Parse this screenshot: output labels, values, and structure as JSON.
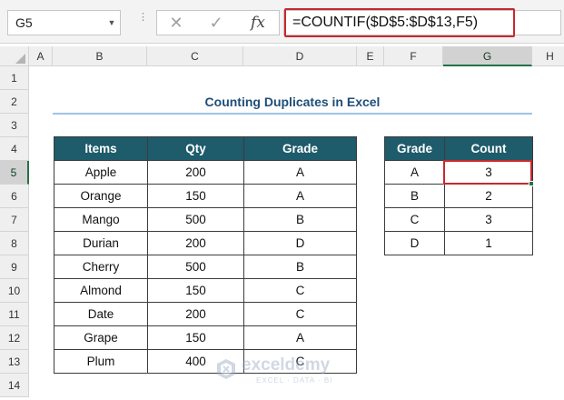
{
  "name_box": {
    "value": "G5"
  },
  "formula_bar": {
    "cancel": "✕",
    "enter": "✓",
    "fx": "fx",
    "formula": "=COUNTIF($D$5:$D$13,F5)"
  },
  "columns": [
    "A",
    "B",
    "C",
    "D",
    "E",
    "F",
    "G",
    "H"
  ],
  "rows": [
    "1",
    "2",
    "3",
    "4",
    "5",
    "6",
    "7",
    "8",
    "9",
    "10",
    "11",
    "12",
    "13",
    "14"
  ],
  "selected": {
    "column": "G",
    "row": "5",
    "cell": "G5"
  },
  "sheet": {
    "title": "Counting Duplicates in Excel",
    "items_table": {
      "headers": [
        "Items",
        "Qty",
        "Grade"
      ],
      "rows": [
        [
          "Apple",
          "200",
          "A"
        ],
        [
          "Orange",
          "150",
          "A"
        ],
        [
          "Mango",
          "500",
          "B"
        ],
        [
          "Durian",
          "200",
          "D"
        ],
        [
          "Cherry",
          "500",
          "B"
        ],
        [
          "Almond",
          "150",
          "C"
        ],
        [
          "Date",
          "200",
          "C"
        ],
        [
          "Grape",
          "150",
          "A"
        ],
        [
          "Plum",
          "400",
          "C"
        ]
      ]
    },
    "count_table": {
      "headers": [
        "Grade",
        "Count"
      ],
      "rows": [
        [
          "A",
          "3"
        ],
        [
          "B",
          "2"
        ],
        [
          "C",
          "3"
        ],
        [
          "D",
          "1"
        ]
      ]
    }
  },
  "watermark": {
    "name": "exceldemy",
    "sub": "EXCEL · DATA · BI"
  },
  "colors": {
    "header_fill": "#1e5b6b",
    "title": "#1f4e79",
    "highlight": "#c8282f",
    "excel_green": "#217346"
  }
}
